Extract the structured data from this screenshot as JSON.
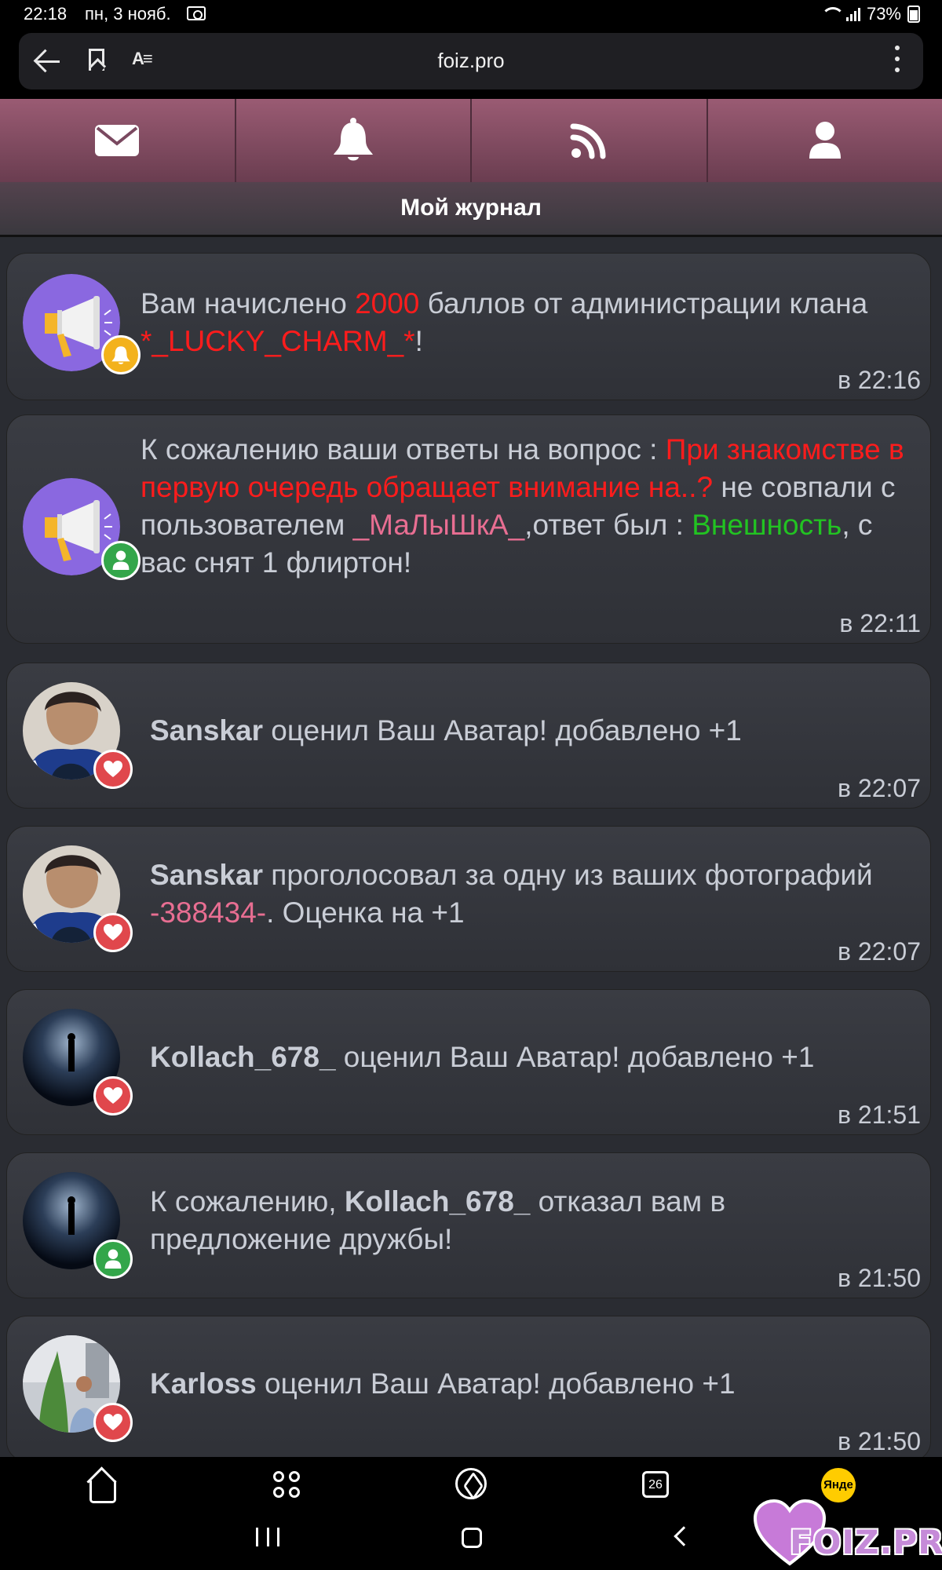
{
  "status_bar": {
    "time": "22:18",
    "date": "пн, 3 нояб.",
    "battery": "73%"
  },
  "browser": {
    "url": "foiz.pro",
    "reader_icon": "A≡"
  },
  "nav_icons": [
    "envelope-icon",
    "bell-icon",
    "rss-icon",
    "user-icon"
  ],
  "page": {
    "title": "Мой журнал"
  },
  "feed": [
    {
      "avatar": "megaphone",
      "badge": "bell",
      "parts": [
        "Вам начислено ",
        "2000",
        " баллов от администрации клана ",
        "*_LUCKY_CHARM_*",
        "!"
      ],
      "time": "в 22:16"
    },
    {
      "avatar": "megaphone",
      "badge": "user",
      "parts": [
        "К сожалению ваши ответы на вопрос : ",
        "При знакомстве в первую очередь обращает внимание на..?",
        " не совпали с пользователем ",
        "_МаЛыШкА_",
        ",ответ был : ",
        "Внешность",
        ", с вас снят 1 флиртон!"
      ],
      "time": "в 22:11"
    },
    {
      "avatar": "photo-man",
      "badge": "heart",
      "user": "Sanskar",
      "text": " оценил Ваш Аватар! добавлено +1",
      "time": "в 22:07"
    },
    {
      "avatar": "photo-man",
      "badge": "heart",
      "user": "Sanskar",
      "parts": [
        " проголосовал за одну из ваших фотографий ",
        "-388434-",
        ". Оценка на +1"
      ],
      "time": "в 22:07"
    },
    {
      "avatar": "photo-night",
      "badge": "heart",
      "user": "Kollach_678_",
      "text": " оценил Ваш Аватар! добавлено +1",
      "time": "в 21:51"
    },
    {
      "avatar": "photo-night",
      "badge": "user",
      "prefix": "К сожалению, ",
      "user": "Kollach_678_",
      "text": " отказал вам в предложение дружбы!",
      "time": "в 21:50"
    },
    {
      "avatar": "photo-street",
      "badge": "heart",
      "user": "Karloss",
      "text": " оценил Ваш Аватар! добавлено +1",
      "time": "в 21:50"
    }
  ],
  "bottom_nav": {
    "calendar_day": "26",
    "yandex_label": "Янде"
  },
  "watermark": "FOIZ.PRO",
  "colors": {
    "nav_gradient_top": "#9a5b73",
    "nav_gradient_bottom": "#6a3d50",
    "card_bg": "#35373d",
    "text": "#c9cdd6",
    "highlight_red": "#ff1c1c",
    "highlight_green": "#22c322",
    "highlight_pink": "#e86e92"
  }
}
